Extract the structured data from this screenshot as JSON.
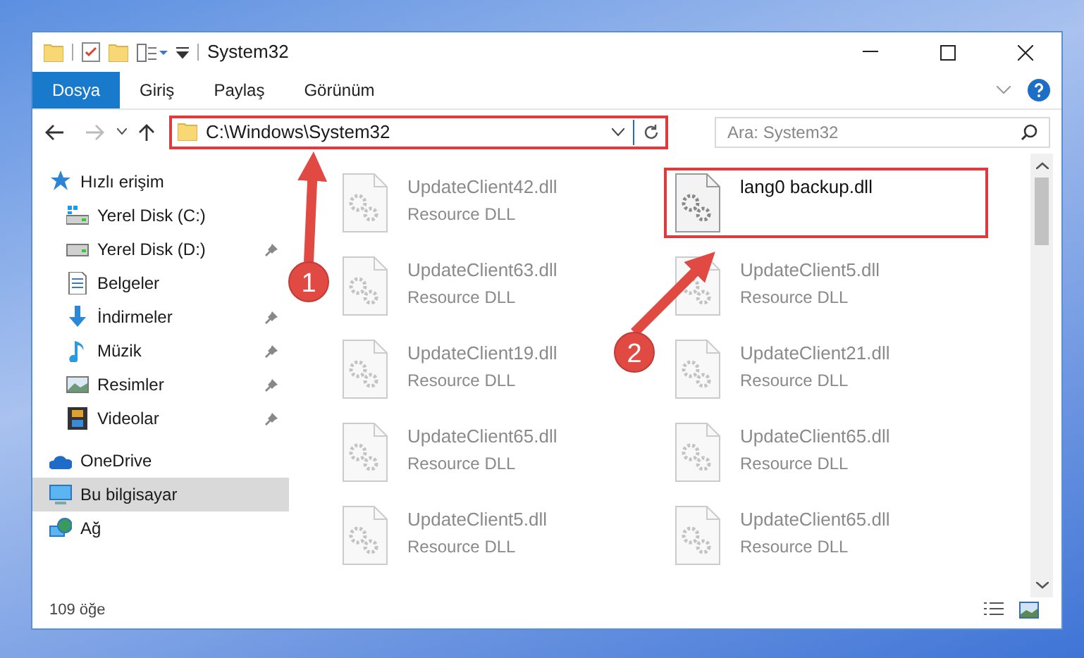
{
  "window": {
    "title": "System32"
  },
  "ribbon_tabs": [
    {
      "label": "Dosya",
      "selected": true
    },
    {
      "label": "Giriş",
      "selected": false
    },
    {
      "label": "Paylaş",
      "selected": false
    },
    {
      "label": "Görünüm",
      "selected": false
    }
  ],
  "address_bar": {
    "path": "C:\\Windows\\System32",
    "highlighted": true
  },
  "search": {
    "placeholder": "Ara: System32"
  },
  "sidebar": {
    "items": [
      {
        "label": "Hızlı erişim",
        "kind": "star",
        "selected": false,
        "children": [
          {
            "label": "Yerel Disk (C:)",
            "kind": "disk-c",
            "pinned": false,
            "selected": false
          },
          {
            "label": "Yerel Disk (D:)",
            "kind": "disk",
            "pinned": true,
            "selected": false
          },
          {
            "label": "Belgeler",
            "kind": "document",
            "pinned": false,
            "selected": false
          },
          {
            "label": "İndirmeler",
            "kind": "download",
            "pinned": true,
            "selected": false
          },
          {
            "label": "Müzik",
            "kind": "music",
            "pinned": true,
            "selected": false
          },
          {
            "label": "Resimler",
            "kind": "picture",
            "pinned": true,
            "selected": false
          },
          {
            "label": "Videolar",
            "kind": "video",
            "pinned": true,
            "selected": false
          }
        ]
      },
      {
        "label": "OneDrive",
        "kind": "cloud",
        "selected": false
      },
      {
        "label": "Bu bilgisayar",
        "kind": "computer",
        "selected": true
      },
      {
        "label": "Ağ",
        "kind": "network",
        "selected": false
      }
    ]
  },
  "files": [
    {
      "name": "UpdateClient42.dll",
      "type": "Resource DLL",
      "blurred": true,
      "highlighted": false
    },
    {
      "name": "lang0 backup.dll",
      "blurred": false,
      "highlighted": true
    },
    {
      "name": "UpdateClient63.dll",
      "type": "Resource DLL",
      "blurred": true,
      "highlighted": false
    },
    {
      "name": "UpdateClient5.dll",
      "type": "Resource DLL",
      "blurred": true,
      "highlighted": false
    },
    {
      "name": "UpdateClient19.dll",
      "type": "Resource DLL",
      "blurred": true,
      "highlighted": false
    },
    {
      "name": "UpdateClient21.dll",
      "type": "Resource DLL",
      "blurred": true,
      "highlighted": false
    },
    {
      "name": "UpdateClient65.dll",
      "type": "Resource DLL",
      "blurred": true,
      "highlighted": false
    },
    {
      "name": "UpdateClient65.dll",
      "type": "Resource DLL",
      "blurred": true,
      "highlighted": false
    },
    {
      "name": "UpdateClient5.dll",
      "type": "Resource DLL",
      "blurred": true,
      "highlighted": false
    },
    {
      "name": "UpdateClient65.dll",
      "type": "Resource DLL",
      "blurred": true,
      "highlighted": false
    }
  ],
  "status_bar": {
    "item_count": "109 öğe"
  },
  "callouts": [
    {
      "number": "1"
    },
    {
      "number": "2"
    }
  ]
}
